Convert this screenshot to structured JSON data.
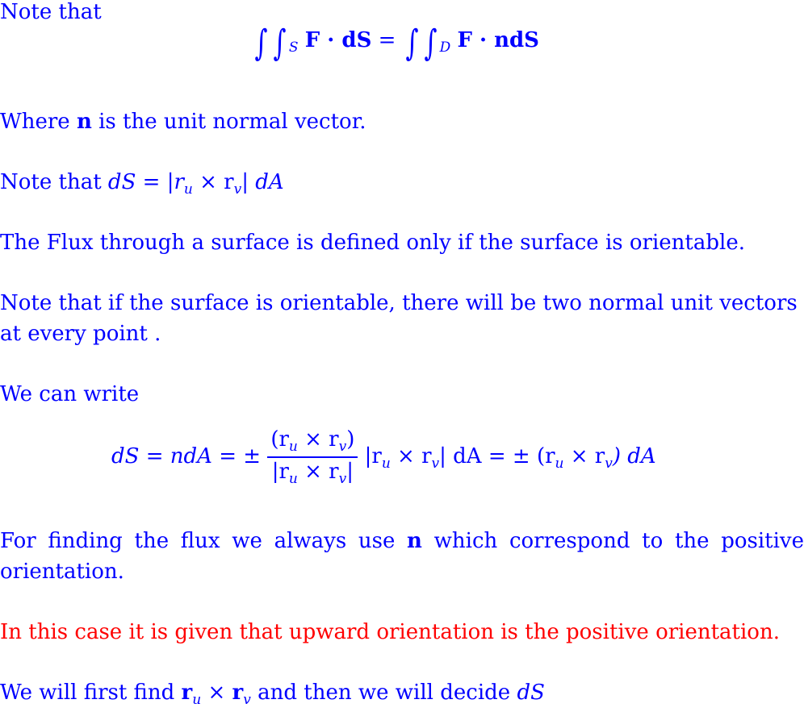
{
  "paragraphs": {
    "p1": "Note that",
    "eq1": {
      "lhs_sub": "S",
      "lhs_body": "F · dS",
      "eq": "=",
      "rhs_sub": "D",
      "rhs_body": "F · ndS"
    },
    "p2_prefix": "Where",
    "p2_bold": "n",
    "p2_suffix": "is the unit normal vector.",
    "p3_prefix": "Note that",
    "p3_math": "dS = |r",
    "p3_math_mid": " × r",
    "p3_math_end": "| dA",
    "sub_u": "u",
    "sub_v": "v",
    "p4": "The Flux through a surface is defined only if the surface is orientable.",
    "p5a": "Note that if the surface is orientable, there will be two normal unit vectors",
    "p5b": "at every point .",
    "p6": "We can write",
    "eq2": {
      "part1": "dS = ndA = ±",
      "num": "(r",
      "num_mid": " × r",
      "num_end": ")",
      "den": "|r",
      "den_mid": " × r",
      "den_end": "|",
      "part2": "|r",
      "part2_mid": " × r",
      "part2_end": "| dA = ± (r",
      "part3_mid": " × r",
      "part3_end": ") dA"
    },
    "p7a_prefix": "For finding the flux we always use",
    "p7a_bold": "n",
    "p7a_suffix": "which correspond to the positive",
    "p7b": "orientation.",
    "p8": "In this case it is given that upward orientation is the positive orientation.",
    "p9_prefix": "We will first find",
    "p9_r1": "r",
    "p9_mid": " × ",
    "p9_r2": "r",
    "p9_suffix": " and then we will decide ",
    "p9_end": "dS"
  },
  "colors": {
    "text": "#0000ff",
    "highlight": "#ff0000"
  }
}
